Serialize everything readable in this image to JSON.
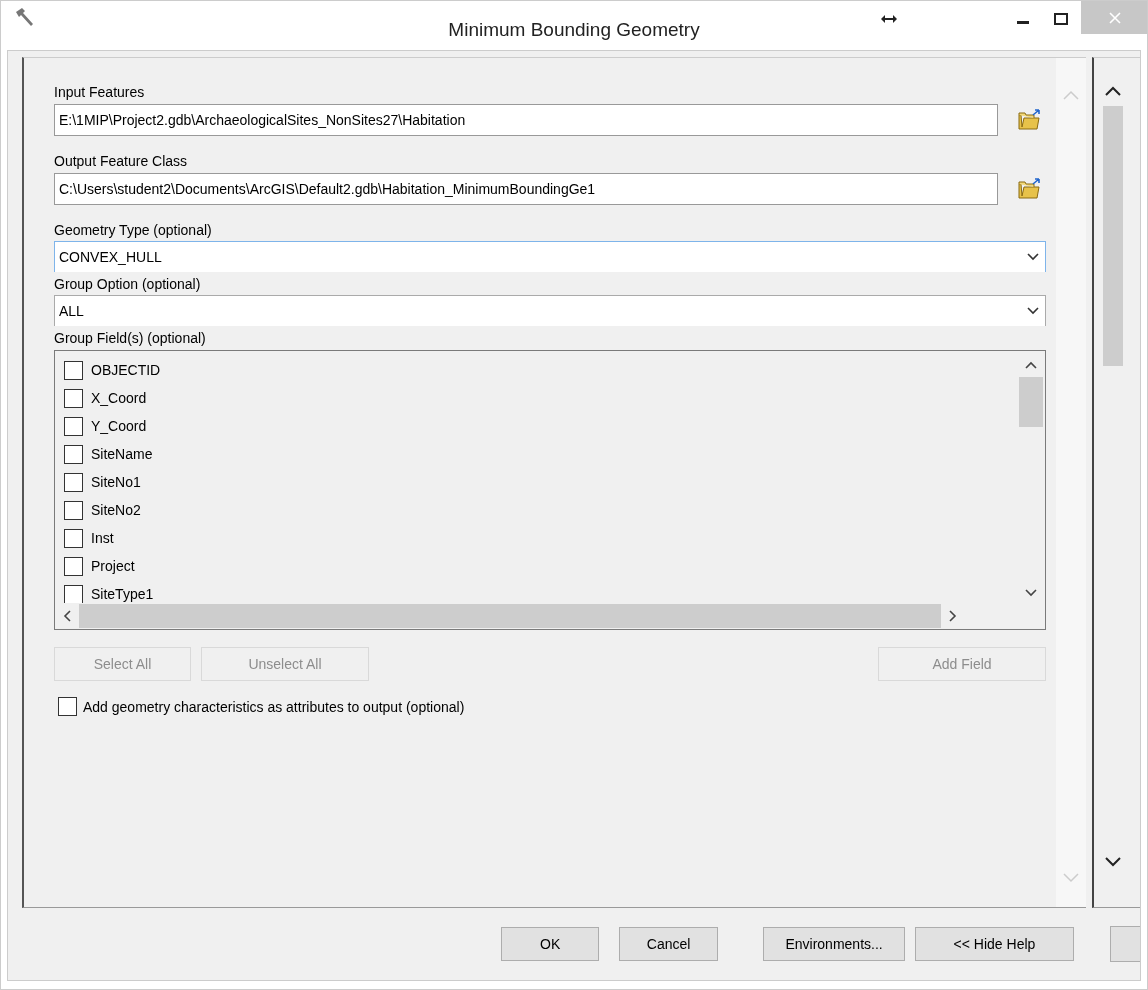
{
  "window": {
    "title": "Minimum Bounding Geometry"
  },
  "parameters": [
    {
      "kind": "path",
      "label": "Input Features",
      "value": "E:\\1MIP\\Project2.gdb\\ArchaeologicalSites_NonSites27\\Habitation"
    },
    {
      "kind": "path",
      "label": "Output Feature Class",
      "value": "C:\\Users\\student2\\Documents\\ArcGIS\\Default2.gdb\\Habitation_MinimumBoundingGe1"
    },
    {
      "kind": "dropdown",
      "label": "Geometry Type (optional)",
      "value": "CONVEX_HULL",
      "focused": true
    },
    {
      "kind": "dropdown",
      "label": "Group Option (optional)",
      "value": "ALL",
      "focused": false
    }
  ],
  "group_fields": {
    "label": "Group Field(s) (optional)",
    "items": [
      {
        "name": "OBJECTID",
        "checked": false
      },
      {
        "name": "X_Coord",
        "checked": false
      },
      {
        "name": "Y_Coord",
        "checked": false
      },
      {
        "name": "SiteName",
        "checked": false
      },
      {
        "name": "SiteNo1",
        "checked": false
      },
      {
        "name": "SiteNo2",
        "checked": false
      },
      {
        "name": "Inst",
        "checked": false
      },
      {
        "name": "Project",
        "checked": false
      },
      {
        "name": "SiteType1",
        "checked": false
      }
    ],
    "buttons": [
      {
        "label": "Select All",
        "disabled": true
      },
      {
        "label": "Unselect All",
        "disabled": true
      },
      {
        "label": "Add Field",
        "disabled": true
      }
    ]
  },
  "add_geometry": {
    "label": "Add geometry characteristics as attributes to output (optional)",
    "checked": false
  },
  "footer_buttons": [
    {
      "label": "OK"
    },
    {
      "label": "Cancel"
    },
    {
      "label": "Environments..."
    },
    {
      "label": "<< Hide Help"
    }
  ]
}
